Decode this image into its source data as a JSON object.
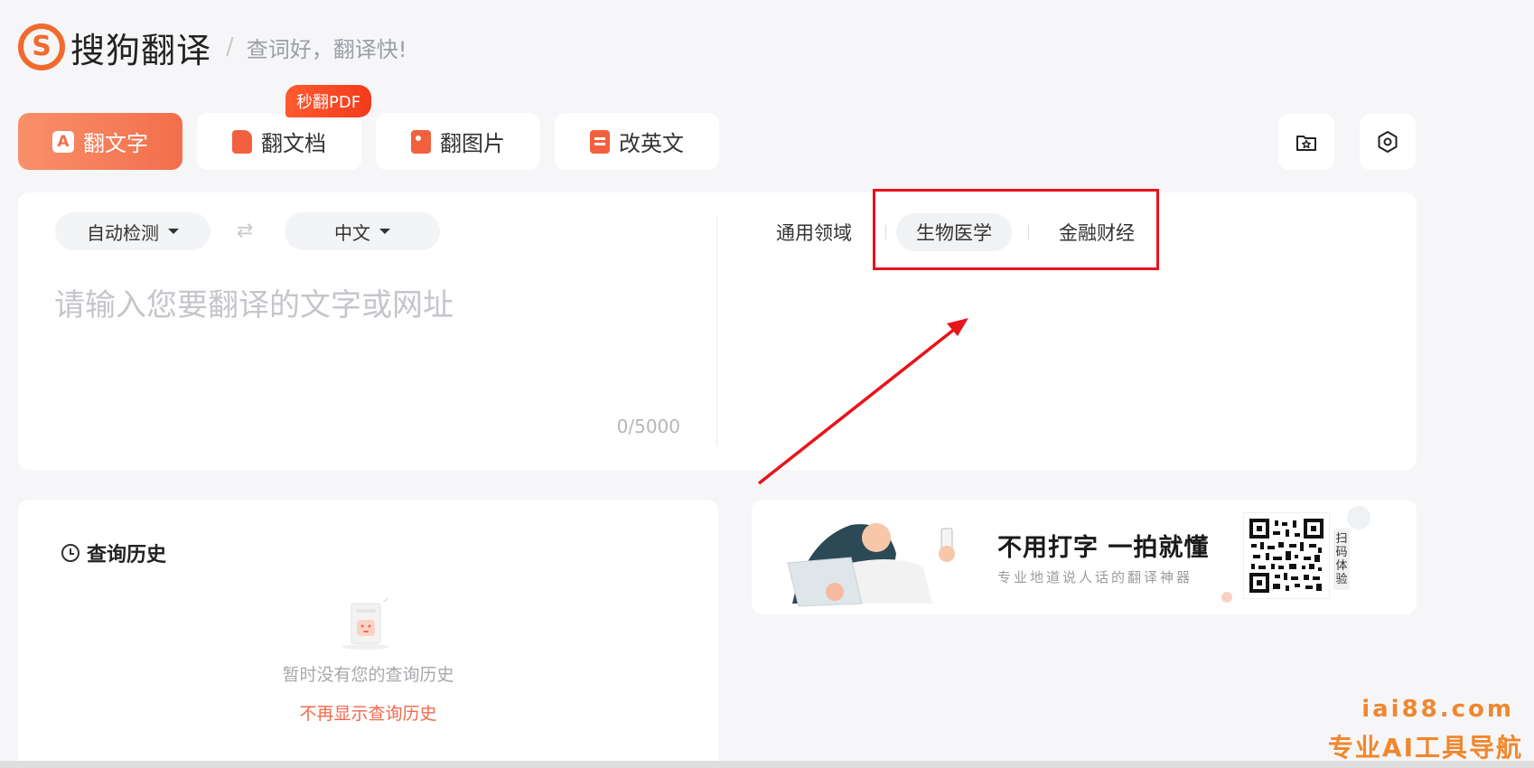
{
  "header": {
    "brand": "搜狗翻译",
    "slogan_sep": "/",
    "slogan": "查词好，翻译快!"
  },
  "tabs": [
    {
      "label": "翻文字",
      "icon": "text-icon",
      "active": true
    },
    {
      "label": "翻文档",
      "icon": "document-icon",
      "active": false
    },
    {
      "label": "翻图片",
      "icon": "image-icon",
      "active": false
    },
    {
      "label": "改英文",
      "icon": "edit-english-icon",
      "active": false
    }
  ],
  "badge": "秒翻PDF",
  "toolbar": {
    "favorites_icon": "star-folder-icon",
    "settings_icon": "gear-icon"
  },
  "languages": {
    "source": "自动检测",
    "swap": "⇄",
    "target": "中文"
  },
  "input": {
    "placeholder": "请输入您要翻译的文字或网址",
    "value": "",
    "counter": "0/5000"
  },
  "domains": [
    {
      "label": "通用领域",
      "selected": false
    },
    {
      "label": "生物医学",
      "selected": true
    },
    {
      "label": "金融财经",
      "selected": false
    }
  ],
  "history": {
    "title": "查询历史",
    "empty_text": "暂时没有您的查询历史",
    "hide_link": "不再显示查询历史"
  },
  "promo": {
    "title": "不用打字 一拍就懂",
    "subtitle": "专业地道说人话的翻译神器",
    "qr_side": "扫码体验"
  },
  "watermark": {
    "domain": "iai88.com",
    "caption": "专业AI工具导航"
  },
  "colors": {
    "accent": "#f36e4b",
    "annotation": "#e8141b",
    "watermark": "#f0872e"
  }
}
